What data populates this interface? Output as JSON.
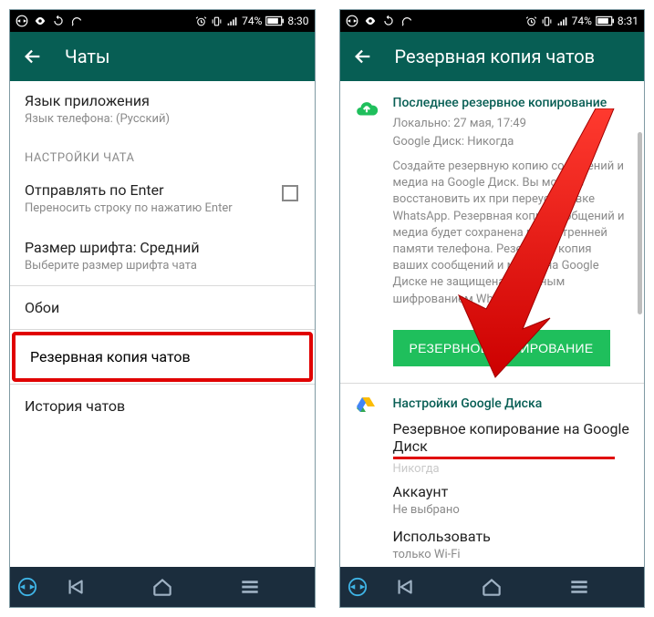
{
  "statusbar": {
    "battery": "74%",
    "time_left": "8:30",
    "time_right": "8:31"
  },
  "left": {
    "title": "Чаты",
    "lang_title": "Язык приложения",
    "lang_sub": "Язык телефона: (Русский)",
    "cat": "НАСТРОЙКИ ЧАТА",
    "enter_title": "Отправлять по Enter",
    "enter_sub": "Переносить строку по нажатию Enter",
    "font_title": "Размер шрифта: Средний",
    "font_sub": "Выберите размер шрифта чата",
    "wallpaper": "Обои",
    "backup": "Резервная копия чатов",
    "history": "История чатов"
  },
  "right": {
    "title": "Резервная копия чатов",
    "sec1": "Последнее резервное копирование",
    "local": "Локально: 27 мая, 17:49",
    "gdrive": "Google Диск: Никогда",
    "info": "Создайте резервную копию сообщений и медиа на Google Диск. Вы можете восстановить их при переустановке WhatsApp. Резервная копия сообщений и медиа будет сохранена во внутренней памяти телефона. Резервная копия ваших сообщений и медиа на Google Диске не защищена сквозным шифрованием WhatsApp.",
    "btn": "РЕЗЕРВНОЕ КОПИРОВАНИЕ",
    "sec2": "Настройки Google Диска",
    "backup_to": "Резервное копирование на Google Диск",
    "backup_to_val": "Никогда",
    "account": "Аккаунт",
    "account_val": "Не выбрано",
    "use": "Использовать",
    "use_val": "только Wi-Fi"
  }
}
